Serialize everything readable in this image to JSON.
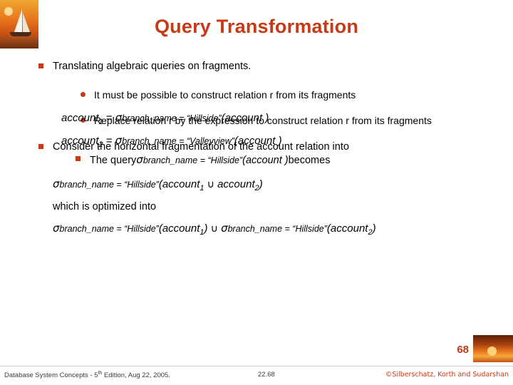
{
  "slide": {
    "title": "Query Transformation",
    "number": "68"
  },
  "bullets": {
    "b1": "Translating algebraic queries on fragments.",
    "b1s1": "It must be possible to construct relation r from its fragments",
    "b1s2": "Replace relation r by the expression to construct relation r from its fragments",
    "b2": "Consider the horizontal fragmentation of the account relation into",
    "b3_pre": "The query",
    "b3_sigma": "σ",
    "b3_cond": "branch_name = “Hillside”",
    "b3_arg": "(account )",
    "b3_post": "becomes"
  },
  "formulas": {
    "f1": {
      "lhs": "account",
      "lhs_sub": "1",
      "eq": " = ",
      "sigma": "σ",
      "cond": "branch_name = “Hillside”",
      "arg": "(account )"
    },
    "f2": {
      "lhs": "account",
      "lhs_sub": "2",
      "eq": " = ",
      "sigma": "σ",
      "cond": "branch_name = “Valleyview”",
      "arg": "(account )"
    },
    "f3": {
      "sigma": "σ",
      "cond": "branch_name = “Hillside”",
      "open": "(account",
      "sub1": "1",
      "union": "∪",
      "arg2": "account",
      "sub2": "2",
      "close": ")"
    },
    "f4": "which is optimized into",
    "f5": {
      "sigma1": "σ",
      "cond1": "branch_name = “Hillside”",
      "arg1": "(account",
      "sub1": "1",
      "close1": ")",
      "union": "∪",
      "sigma2": "σ",
      "cond2": "branch_name = “Hillside”",
      "arg2": "(account",
      "sub2": "2",
      "close2": ")"
    }
  },
  "footer": {
    "left_a": "Database System Concepts - 5",
    "left_sup": "th",
    "left_b": " Edition, Aug 22, 2005.",
    "center": "22.68",
    "right": "©Silberschatz, Korth and Sudarshan"
  }
}
